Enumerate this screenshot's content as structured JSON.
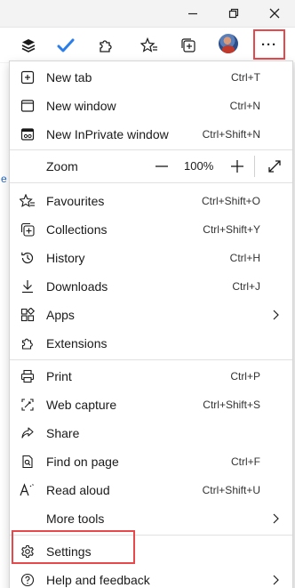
{
  "window_controls": {
    "minimize_icon": "minimize-icon",
    "restore_icon": "restore-icon",
    "close_icon": "close-icon"
  },
  "toolbar": {
    "icons": [
      "layers-icon",
      "checkmark-icon",
      "extensions-icon",
      "favourites-icon",
      "collections-icon",
      "profile-avatar"
    ],
    "more_label": "···"
  },
  "menu": {
    "group1": [
      {
        "label": "New tab",
        "shortcut": "Ctrl+T",
        "icon": "new-tab-icon"
      },
      {
        "label": "New window",
        "shortcut": "Ctrl+N",
        "icon": "new-window-icon"
      },
      {
        "label": "New InPrivate window",
        "shortcut": "Ctrl+Shift+N",
        "icon": "inprivate-icon"
      }
    ],
    "zoom": {
      "label": "Zoom",
      "value": "100%",
      "minus": "—",
      "plus": "+"
    },
    "group2": [
      {
        "label": "Favourites",
        "shortcut": "Ctrl+Shift+O",
        "icon": "favourites-icon"
      },
      {
        "label": "Collections",
        "shortcut": "Ctrl+Shift+Y",
        "icon": "collections-icon"
      },
      {
        "label": "History",
        "shortcut": "Ctrl+H",
        "icon": "history-icon"
      },
      {
        "label": "Downloads",
        "shortcut": "Ctrl+J",
        "icon": "downloads-icon"
      },
      {
        "label": "Apps",
        "shortcut": "",
        "icon": "apps-icon",
        "submenu": true
      },
      {
        "label": "Extensions",
        "shortcut": "",
        "icon": "extensions-icon"
      }
    ],
    "group3": [
      {
        "label": "Print",
        "shortcut": "Ctrl+P",
        "icon": "print-icon"
      },
      {
        "label": "Web capture",
        "shortcut": "Ctrl+Shift+S",
        "icon": "web-capture-icon"
      },
      {
        "label": "Share",
        "shortcut": "",
        "icon": "share-icon"
      },
      {
        "label": "Find on page",
        "shortcut": "Ctrl+F",
        "icon": "find-icon"
      },
      {
        "label": "Read aloud",
        "shortcut": "Ctrl+Shift+U",
        "icon": "read-aloud-icon"
      },
      {
        "label": "More tools",
        "shortcut": "",
        "icon": "",
        "submenu": true
      }
    ],
    "group4": [
      {
        "label": "Settings",
        "shortcut": "",
        "icon": "settings-icon"
      },
      {
        "label": "Help and feedback",
        "shortcut": "",
        "icon": "help-icon",
        "submenu": true
      }
    ]
  },
  "colors": {
    "highlight": "#e8474c",
    "accent": "#2266c2"
  }
}
